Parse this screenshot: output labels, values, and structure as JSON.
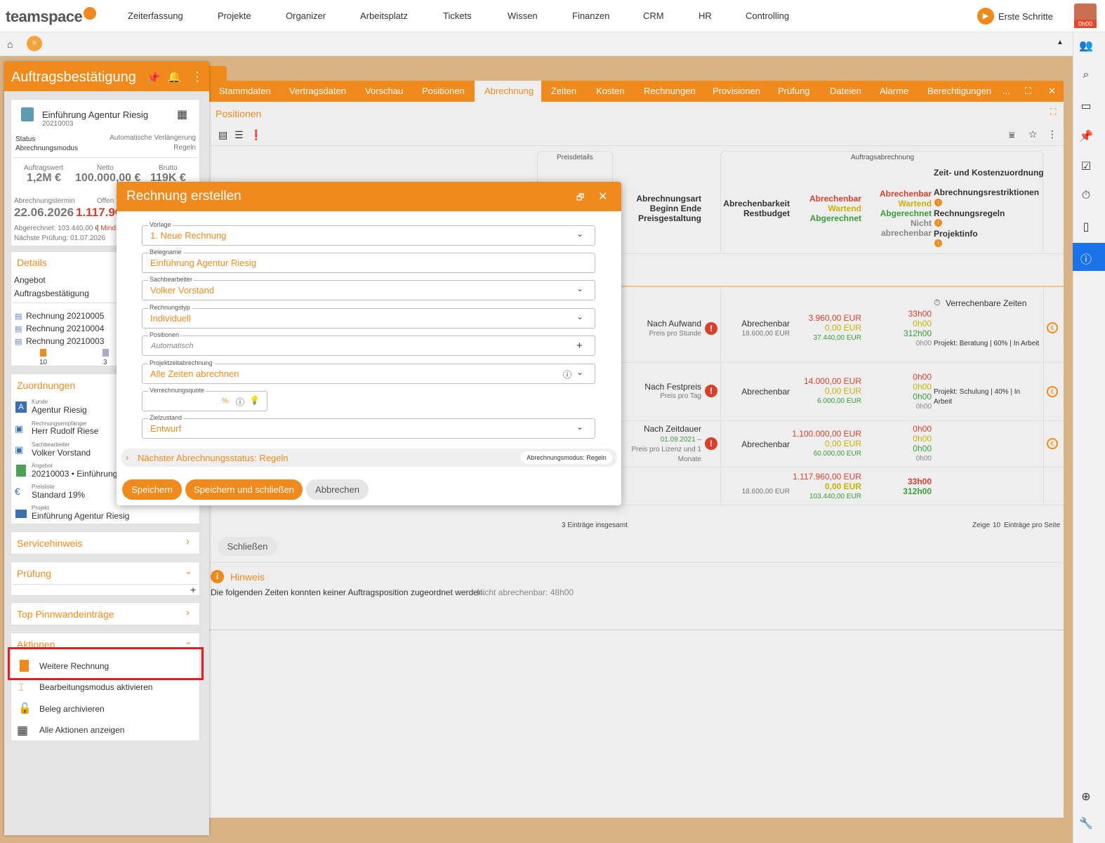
{
  "app": {
    "logo": "teamspace",
    "nav": [
      "Zeiterfassung",
      "Projekte",
      "Organizer",
      "Arbeitsplatz",
      "Tickets",
      "Wissen",
      "Finanzen",
      "CRM",
      "HR",
      "Controlling"
    ],
    "erste_schritte": "Erste Schritte",
    "timer": "0h00"
  },
  "left": {
    "title": "Auftragsbestätigung",
    "record_name": "Einführung Agentur Riesig",
    "record_number": "20210003",
    "status_label": "Status",
    "status_value": "Automatische Verlängerung",
    "mode_label": "Abrechnungsmodus",
    "mode_value": "Regeln",
    "auftragswert_label": "Auftragswert",
    "auftragswert_value": "1,2M €",
    "netto_label": "Netto",
    "netto_value": "100.000,00 €",
    "brutto_label": "Brutto",
    "brutto_value": "119K €",
    "termin_label": "Abrechnungstermin",
    "termin_value": "22.06.2026",
    "offen_label": "Offen",
    "offen_value": "1.117.9€",
    "abgerechnet": "Abgerechnet: 103.440,00 €",
    "mind": "| Mind",
    "naechste_pruefung": "Nächste Prüfung: 01.07.2026",
    "details_title": "Details",
    "details_items": [
      "Angebot",
      "Auftragsbestätigung"
    ],
    "rechnungen": [
      "Rechnung 20210005",
      "Rechnung 20210004",
      "Rechnung 20210003"
    ],
    "count_a": "10",
    "count_b": "3",
    "zuordnungen_title": "Zuordnungen",
    "zuordnungen": [
      {
        "label": "Kunde",
        "value": "Agentur Riesig"
      },
      {
        "label": "Rechnungsempfänger",
        "value": "Herr Rudolf Riese"
      },
      {
        "label": "Sachbearbeiter",
        "value": "Volker Vorstand"
      },
      {
        "label": "Angebot",
        "value": "20210003 • Einführung"
      },
      {
        "label": "Preisliste",
        "value": "Standard 19%"
      },
      {
        "label": "Projekt",
        "value": "Einführung Agentur Riesig"
      }
    ],
    "servicehinweis": "Servicehinweis",
    "pruefung": "Prüfung",
    "pinnwand": "Top Pinnwandeinträge",
    "aktionen": "Aktionen",
    "actions": [
      "Weitere Rechnung",
      "Bearbeitungsmodus aktivieren",
      "Beleg archivieren",
      "Alle Aktionen anzeigen"
    ]
  },
  "tabs": [
    "Stammdaten",
    "Vertragsdaten",
    "Vorschau",
    "Positionen",
    "Abrechnung",
    "Zeiten",
    "Kosten",
    "Rechnungen",
    "Provisionen",
    "Prüfung",
    "Dateien",
    "Alarme",
    "Berechtigungen",
    "..."
  ],
  "section_title": "Positionen",
  "table": {
    "group_preisdetails": "Preisdetails",
    "group_auftragsabrechnung": "Auftragsabrechnung",
    "zeit_kosten": "Zeit- und Kostenzuordnung",
    "h_abrechnungsart": "Abrechnungsart",
    "h_beginn_ende": "Beginn Ende",
    "h_preisgestaltung": "Preisgestaltung",
    "h_abrechenbarkeit": "Abrechenbarkeit",
    "h_restbudget": "Restbudget",
    "h_abrechenbar": "Abrechenbar",
    "h_wartend": "Wartend",
    "h_abgerechnet": "Abgerechnet",
    "h_nicht": "Nicht abrechenbar",
    "h_restriktionen": "Abrechnungsrestriktionen",
    "h_regeln": "Rechnungsregeln",
    "h_projektinfo": "Projektinfo",
    "verrechenbare": "Verrechenbare Zeiten",
    "rows": [
      {
        "art": "Nach Aufwand",
        "sub": "Preis pro Stunde",
        "date": "",
        "abr": "Abrechenbar",
        "rest": "18.600,00 EUR",
        "a": "3.960,00 EUR",
        "w": "0,00 EUR",
        "g": "37.440,00 EUR",
        "ta": "33h00",
        "tw": "0h00",
        "tg": "312h00",
        "tn": "0h00",
        "proj": "Projekt: Beratung | 60% | In Arbeit"
      },
      {
        "art": "Nach Festpreis",
        "sub": "Preis pro Tag",
        "date": "",
        "abr": "Abrechenbar",
        "rest": "",
        "a": "14.000,00 EUR",
        "w": "0,00 EUR",
        "g": "6.000,00 EUR",
        "ta": "0h00",
        "tw": "0h00",
        "tg": "0h00",
        "tn": "0h00",
        "proj": "Projekt: Schulung | 40% | In Arbeit"
      },
      {
        "art": "Nach Zeitdauer",
        "sub": "Preis pro Lizenz und 1 Monate",
        "date": "01.09.2021 –",
        "abr": "Abrechenbar",
        "rest": "",
        "a": "1.100.000,00 EUR",
        "w": "0,00 EUR",
        "g": "60.000,00 EUR",
        "ta": "0h00",
        "tw": "0h00",
        "tg": "0h00",
        "tn": "0h00",
        "proj": ""
      }
    ],
    "total": {
      "rest": "18.600,00 EUR",
      "a": "1.117.960,00 EUR",
      "w": "0,00 EUR",
      "g": "103.440,00 EUR",
      "ta": "33h00",
      "tg": "312h00"
    },
    "count": "3 Einträge insgesamt",
    "zeige": "Zeige",
    "per_page": "10",
    "pro_seite": "Einträge pro Seite"
  },
  "schliessen": "Schließen",
  "hinweis_title": "Hinweis",
  "hinweis_text": "Die folgenden Zeiten konnten keiner Auftragsposition zugeordnet werden:",
  "hinweis_value": "Nicht abrechenbar: 48h00",
  "dialog": {
    "title": "Rechnung erstellen",
    "vorlage_label": "Vorlage",
    "vorlage_value": "1. Neue Rechnung",
    "belegname_label": "Belegname",
    "belegname_value": "Einführung Agentur Riesig",
    "sachbearbeiter_label": "Sachbearbeiter",
    "sachbearbeiter_value": "Volker Vorstand",
    "rechnungstyp_label": "Rechnungstyp",
    "rechnungstyp_value": "Individuell",
    "positionen_label": "Positionen",
    "positionen_placeholder": "Automatisch",
    "projektzeit_label": "Projektzeitabrechnung",
    "projektzeit_value": "Alle Zeiten abrechnen",
    "quote_label": "Verrechnungsquote",
    "quote_unit": "%",
    "zielzustand_label": "Zielzustand",
    "zielzustand_value": "Entwurf",
    "next_status": "Nächster Abrechnungsstatus: Regeln",
    "mode_badge": "Abrechnungsmodus: Regeln",
    "save": "Speichern",
    "save_close": "Speichern und schließen",
    "cancel": "Abbrechen"
  }
}
